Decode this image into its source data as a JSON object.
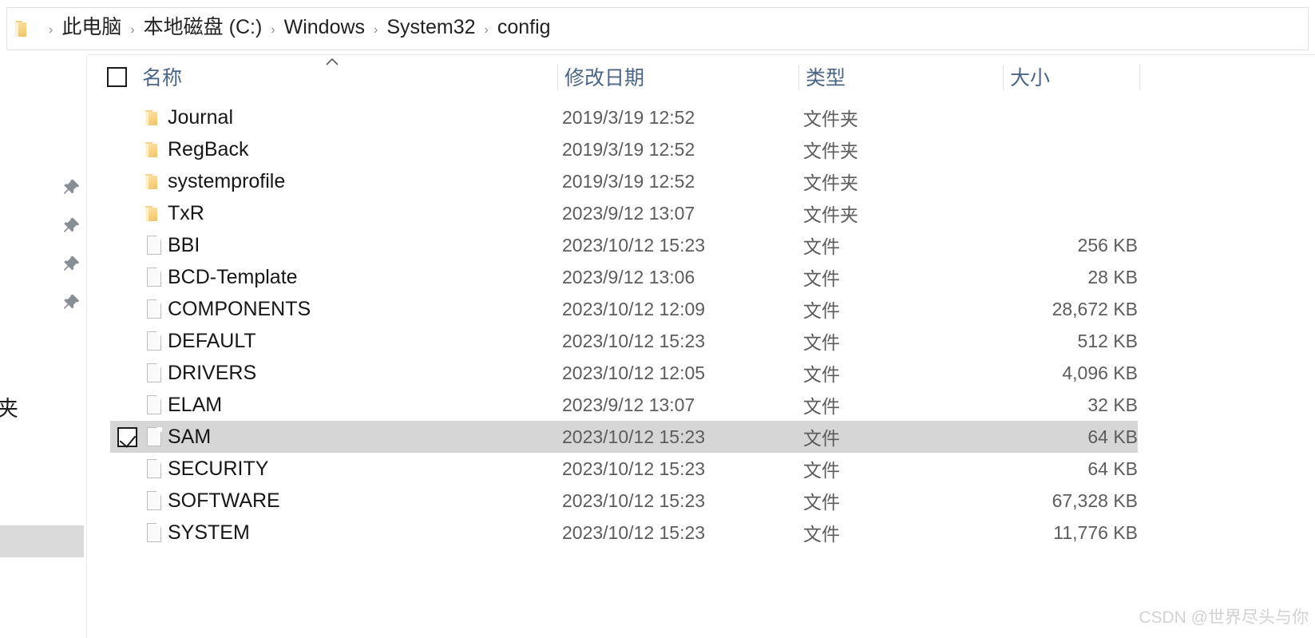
{
  "breadcrumb": {
    "folder_icon": "folder-icon",
    "separator": "›",
    "segments": [
      "此电脑",
      "本地磁盘 (C:)",
      "Windows",
      "System32",
      "config"
    ]
  },
  "columns": {
    "name": "名称",
    "date_modified": "修改日期",
    "type": "类型",
    "size": "大小"
  },
  "sort": {
    "column": "名称",
    "direction": "ascending",
    "indicator": "caret-up-icon"
  },
  "select_all_checkbox": {
    "checked": false
  },
  "nav_pane": {
    "pin_icons": [
      "pin-icon",
      "pin-icon",
      "pin-icon",
      "pin-icon"
    ],
    "clipped_label": "夹"
  },
  "type_labels": {
    "folder": "文件夹",
    "file": "文件"
  },
  "rows": [
    {
      "name": "Journal",
      "date": "2019/3/19 12:52",
      "type": "文件夹",
      "size": "",
      "icon": "folder-icon",
      "selected": false,
      "checked": false
    },
    {
      "name": "RegBack",
      "date": "2019/3/19 12:52",
      "type": "文件夹",
      "size": "",
      "icon": "folder-icon",
      "selected": false,
      "checked": false
    },
    {
      "name": "systemprofile",
      "date": "2019/3/19 12:52",
      "type": "文件夹",
      "size": "",
      "icon": "folder-icon",
      "selected": false,
      "checked": false
    },
    {
      "name": "TxR",
      "date": "2023/9/12 13:07",
      "type": "文件夹",
      "size": "",
      "icon": "folder-icon",
      "selected": false,
      "checked": false
    },
    {
      "name": "BBI",
      "date": "2023/10/12 15:23",
      "type": "文件",
      "size": "256 KB",
      "icon": "file-icon",
      "selected": false,
      "checked": false
    },
    {
      "name": "BCD-Template",
      "date": "2023/9/12 13:06",
      "type": "文件",
      "size": "28 KB",
      "icon": "file-icon",
      "selected": false,
      "checked": false
    },
    {
      "name": "COMPONENTS",
      "date": "2023/10/12 12:09",
      "type": "文件",
      "size": "28,672 KB",
      "icon": "file-icon",
      "selected": false,
      "checked": false
    },
    {
      "name": "DEFAULT",
      "date": "2023/10/12 15:23",
      "type": "文件",
      "size": "512 KB",
      "icon": "file-icon",
      "selected": false,
      "checked": false
    },
    {
      "name": "DRIVERS",
      "date": "2023/10/12 12:05",
      "type": "文件",
      "size": "4,096 KB",
      "icon": "file-icon",
      "selected": false,
      "checked": false
    },
    {
      "name": "ELAM",
      "date": "2023/9/12 13:07",
      "type": "文件",
      "size": "32 KB",
      "icon": "file-icon",
      "selected": false,
      "checked": false
    },
    {
      "name": "SAM",
      "date": "2023/10/12 15:23",
      "type": "文件",
      "size": "64 KB",
      "icon": "file-icon",
      "selected": true,
      "checked": true
    },
    {
      "name": "SECURITY",
      "date": "2023/10/12 15:23",
      "type": "文件",
      "size": "64 KB",
      "icon": "file-icon",
      "selected": false,
      "checked": false
    },
    {
      "name": "SOFTWARE",
      "date": "2023/10/12 15:23",
      "type": "文件",
      "size": "67,328 KB",
      "icon": "file-icon",
      "selected": false,
      "checked": false
    },
    {
      "name": "SYSTEM",
      "date": "2023/10/12 15:23",
      "type": "文件",
      "size": "11,776 KB",
      "icon": "file-icon",
      "selected": false,
      "checked": false
    }
  ],
  "watermark": "CSDN @世界尽头与你",
  "colors": {
    "header_text": "#4a6585",
    "row_text": "#161616",
    "meta_text": "#5c5c5c",
    "selection": "#d6d6d6",
    "folder": "#f7d184",
    "watermark": "#d2d2d2"
  }
}
